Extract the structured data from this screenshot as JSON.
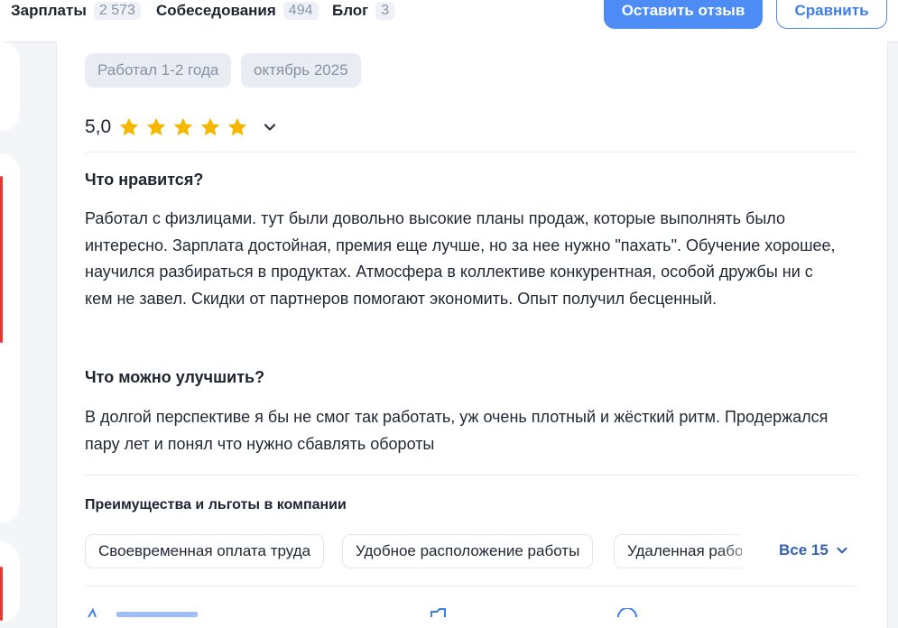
{
  "nav": {
    "items": [
      {
        "label": "Зарплаты",
        "count": "2 573"
      },
      {
        "label": "Собеседования",
        "count": "494"
      },
      {
        "label": "Блог",
        "count": "3"
      }
    ],
    "leave_review": "Оставить отзыв",
    "compare": "Сравнить"
  },
  "review": {
    "tags": [
      "Работал 1-2 года",
      "октябрь 2025"
    ],
    "rating": "5,0",
    "stars": 5,
    "likes_title": "Что нравится?",
    "likes_text": "Работал с физлицами. тут были довольно высокие планы продаж, которые выполнять было интересно. Зарплата достойная, премия еще лучше, но за нее нужно \"пахать\". Обучение хорошее, научился разбираться в продуктах. Атмосфера в коллективе конкурентная, особой дружбы ни с кем не завел. Скидки от партнеров помогают экономить. Опыт получил бесценный.",
    "improve_title": "Что можно улучшить?",
    "improve_text": "В долгой перспективе я бы не смог так работать, уж очень плотный и жёсткий ритм. Продержался пару лет и понял что нужно сбавлять обороты",
    "benefits_title": "Преимущества и льготы в компании",
    "benefits": [
      "Своевременная оплата труда",
      "Удобное расположение работы",
      "Удаленная работа"
    ],
    "all_benefits": "Все 15"
  },
  "colors": {
    "accent": "#4d8cf5",
    "star": "#f5b800",
    "sidebar_red": "#e8372f",
    "link": "#3362b4"
  }
}
